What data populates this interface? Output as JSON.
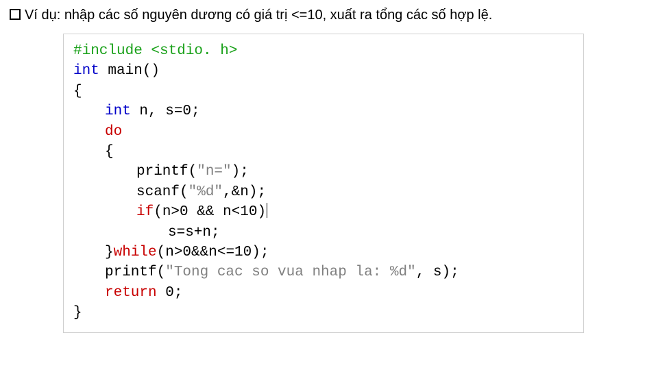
{
  "heading": "Ví dụ: nhập các số nguyên dương có giá trị <=10, xuất ra tổng các số hợp lệ.",
  "code": {
    "l01": {
      "a": "#include <stdio. h>"
    },
    "l02": {
      "a": "int",
      "b": " main()"
    },
    "l03": {
      "a": "{"
    },
    "l04": {
      "a": "int",
      "b": " n, s=0;"
    },
    "l05": {
      "a": "do"
    },
    "l06": {
      "a": "{"
    },
    "l07": {
      "a": "printf(",
      "b": "\"n=\"",
      "c": ");"
    },
    "l08": {
      "a": "scanf(",
      "b": "\"%d\"",
      "c": ",&n);"
    },
    "l09": {
      "a": "if",
      "b": "(n>0 && n<10)"
    },
    "l10": {
      "a": "s=s+n;"
    },
    "l11": {
      "a": "}",
      "b": "while",
      "c": "(n>0&&n<=10);"
    },
    "l12": {
      "a": "printf(",
      "b": "\"Tong cac so vua nhap la: %d\"",
      "c": ", s);"
    },
    "l13": {
      "a": "return",
      "b": " 0;"
    },
    "l14": {
      "a": "}"
    }
  }
}
